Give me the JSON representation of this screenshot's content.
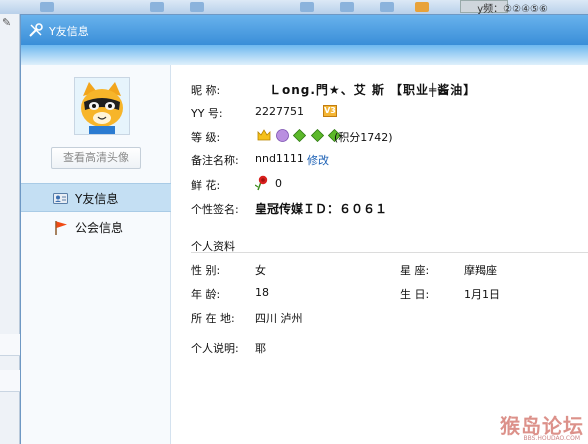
{
  "window": {
    "title": "Y友信息"
  },
  "background": {
    "username": "y频：②②④⑤⑥"
  },
  "sidebar": {
    "hd_avatar_button": "查看高清头像",
    "items": [
      {
        "label": "Y友信息",
        "icon": "person-card-icon",
        "active": true
      },
      {
        "label": "公会信息",
        "icon": "flag-icon",
        "active": false
      }
    ]
  },
  "profile": {
    "nickname": {
      "label": "昵    称:",
      "value": "Ｌong.門★、艾  斯  【职业╪酱油】"
    },
    "yy": {
      "label": "YY    号:",
      "value": "2227751",
      "badge": "V3"
    },
    "level": {
      "label": "等    级:",
      "points": "(积分1742)"
    },
    "remark": {
      "label": "备注名称:",
      "value": "nnd1111",
      "edit": "修改"
    },
    "flowers": {
      "label": "鲜    花:",
      "value": "0"
    },
    "signature": {
      "label": "个性签名:",
      "value": "皇冠传媒ＩＤ：６０６１"
    }
  },
  "personal": {
    "section_title": "个人资料",
    "gender": {
      "label": "性    别:",
      "value": "女"
    },
    "zodiac": {
      "label": "星    座:",
      "value": "摩羯座"
    },
    "age": {
      "label": "年    龄:",
      "value": "18"
    },
    "birthday": {
      "label": "生    日:",
      "value": "1月1日"
    },
    "location": {
      "label": "所 在 地:",
      "value": "四川  泸州"
    },
    "bio": {
      "label": "个人说明:",
      "value": "耶"
    }
  },
  "watermark": {
    "text": "猴岛论坛",
    "sub": "BBS.HOUDAO.COM"
  },
  "colors": {
    "title_bar": "#3a8ed8",
    "active_nav": "#c4dff3",
    "link": "#1a5fb4"
  }
}
